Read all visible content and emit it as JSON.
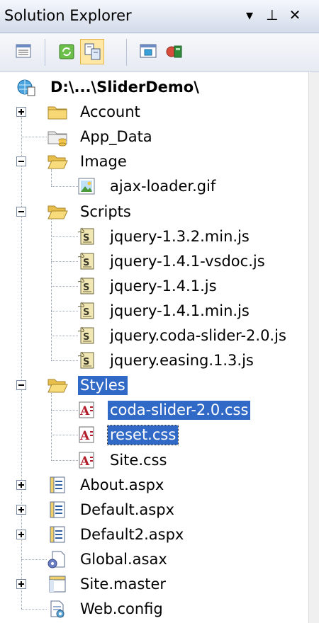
{
  "window": {
    "title": "Solution Explorer",
    "controls": [
      "▾",
      "⊥",
      "✕"
    ]
  },
  "toolbar": {
    "buttons": [
      {
        "name": "properties-button",
        "icon": "properties-icon",
        "active": false
      },
      {
        "name": "refresh-button",
        "icon": "refresh-icon",
        "active": false
      },
      {
        "name": "nest-related-files-button",
        "icon": "nest-files-icon",
        "active": true
      },
      {
        "name": "view-designer-button",
        "icon": "view-designer-icon",
        "active": false
      },
      {
        "name": "copy-website-button",
        "icon": "copy-website-icon",
        "active": false
      }
    ]
  },
  "tree": [
    {
      "label": "D:\\...\\SliderDemo\\",
      "level": 0,
      "icon": "web-project-icon",
      "expander": null,
      "bold": true
    },
    {
      "label": "Account",
      "level": 1,
      "icon": "folder-icon",
      "expander": "plus"
    },
    {
      "label": "App_Data",
      "level": 1,
      "icon": "app-data-folder-icon",
      "expander": null
    },
    {
      "label": "Image",
      "level": 1,
      "icon": "folder-open-icon",
      "expander": "minus"
    },
    {
      "label": "ajax-loader.gif",
      "level": 2,
      "icon": "image-file-icon",
      "expander": null
    },
    {
      "label": "Scripts",
      "level": 1,
      "icon": "folder-open-icon",
      "expander": "minus"
    },
    {
      "label": "jquery-1.3.2.min.js",
      "level": 2,
      "icon": "js-file-icon",
      "expander": null
    },
    {
      "label": "jquery-1.4.1-vsdoc.js",
      "level": 2,
      "icon": "js-file-icon",
      "expander": null
    },
    {
      "label": "jquery-1.4.1.js",
      "level": 2,
      "icon": "js-file-icon",
      "expander": null
    },
    {
      "label": "jquery-1.4.1.min.js",
      "level": 2,
      "icon": "js-file-icon",
      "expander": null
    },
    {
      "label": "jquery.coda-slider-2.0.js",
      "level": 2,
      "icon": "js-file-icon",
      "expander": null
    },
    {
      "label": "jquery.easing.1.3.js",
      "level": 2,
      "icon": "js-file-icon",
      "expander": null
    },
    {
      "label": "Styles",
      "level": 1,
      "icon": "folder-open-icon",
      "expander": "minus",
      "selected": true
    },
    {
      "label": "coda-slider-2.0.css",
      "level": 2,
      "icon": "css-file-icon",
      "expander": null,
      "selected": true
    },
    {
      "label": "reset.css",
      "level": 2,
      "icon": "css-file-icon",
      "expander": null,
      "selected": true,
      "focused": true
    },
    {
      "label": "Site.css",
      "level": 2,
      "icon": "css-file-icon",
      "expander": null
    },
    {
      "label": "About.aspx",
      "level": 1,
      "icon": "aspx-file-icon",
      "expander": "plus"
    },
    {
      "label": "Default.aspx",
      "level": 1,
      "icon": "aspx-file-icon",
      "expander": "plus"
    },
    {
      "label": "Default2.aspx",
      "level": 1,
      "icon": "aspx-file-icon",
      "expander": "plus"
    },
    {
      "label": "Global.asax",
      "level": 1,
      "icon": "global-asax-icon",
      "expander": null
    },
    {
      "label": "Site.master",
      "level": 1,
      "icon": "master-page-icon",
      "expander": "plus"
    },
    {
      "label": "Web.config",
      "level": 1,
      "icon": "config-file-icon",
      "expander": null
    }
  ]
}
